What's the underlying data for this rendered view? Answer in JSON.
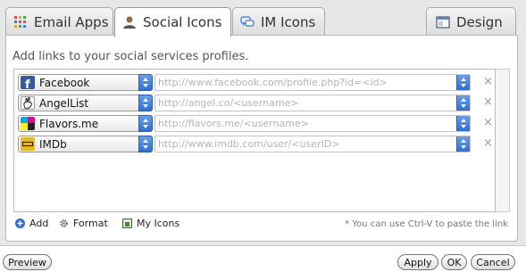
{
  "tabs": [
    {
      "label": "Email Apps",
      "icon": "grid-apps-icon"
    },
    {
      "label": "Social Icons",
      "icon": "person-icon"
    },
    {
      "label": "IM Icons",
      "icon": "chat-bubbles-icon"
    },
    {
      "label": "Design",
      "icon": "window-icon"
    }
  ],
  "active_tab": "Social Icons",
  "hint": "Add links to your social services profiles.",
  "rows": [
    {
      "service": "Facebook",
      "placeholder": "http://www.facebook.com/profile.php?id=<id>",
      "logo": "facebook-logo-icon"
    },
    {
      "service": "AngelList",
      "placeholder": "http://angel.co/<username>",
      "logo": "angellist-logo-icon"
    },
    {
      "service": "Flavors.me",
      "placeholder": "http://flavors.me/<username>",
      "logo": "flavors-logo-icon"
    },
    {
      "service": "IMDb",
      "placeholder": "http://www.imdb.com/user/<userID>",
      "logo": "imdb-logo-icon"
    }
  ],
  "remove_symbol": "×",
  "footer": {
    "add_label": "Add",
    "format_label": "Format",
    "my_icons_label": "My Icons",
    "note": "* You can use Ctrl-V to paste the link"
  },
  "buttons": {
    "preview": "Preview",
    "apply": "Apply",
    "ok": "OK",
    "cancel": "Cancel"
  },
  "colors": {
    "facebook": "#3b5998",
    "imdb": "#e6b91e",
    "accent_blue": "#2f6fd3"
  }
}
